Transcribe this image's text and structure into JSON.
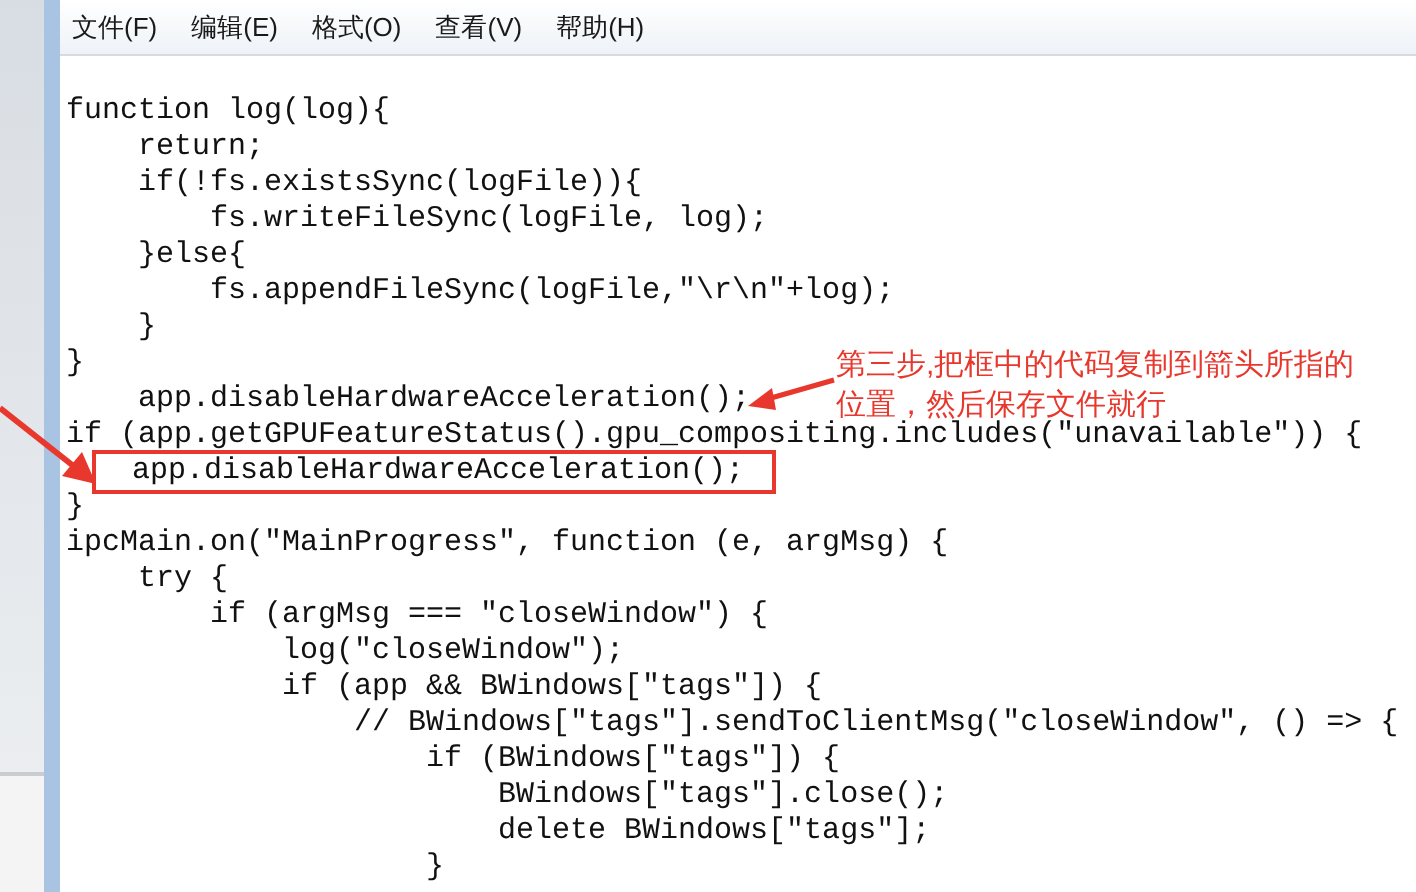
{
  "menu": [
    "文件(F)",
    "编辑(E)",
    "格式(O)",
    "查看(V)",
    "帮助(H)"
  ],
  "code_lines": [
    {
      "text": "function log(log){",
      "boxed": false
    },
    {
      "text": "    return;",
      "boxed": false
    },
    {
      "text": "    if(!fs.existsSync(logFile)){",
      "boxed": false
    },
    {
      "text": "        fs.writeFileSync(logFile, log);",
      "boxed": false
    },
    {
      "text": "    }else{",
      "boxed": false
    },
    {
      "text": "        fs.appendFileSync(logFile,\"\\r\\n\"+log);",
      "boxed": false
    },
    {
      "text": "    }",
      "boxed": false
    },
    {
      "text": "}",
      "boxed": false
    },
    {
      "text": "    app.disableHardwareAcceleration();",
      "boxed": false
    },
    {
      "text": "if (app.getGPUFeatureStatus().gpu_compositing.includes(\"unavailable\")) {",
      "boxed": false
    },
    {
      "text": "    app.disableHardwareAcceleration();",
      "boxed": true
    },
    {
      "text": "}",
      "boxed": false
    },
    {
      "text": "ipcMain.on(\"MainProgress\", function (e, argMsg) {",
      "boxed": false
    },
    {
      "text": "    try {",
      "boxed": false
    },
    {
      "text": "        if (argMsg === \"closeWindow\") {",
      "boxed": false
    },
    {
      "text": "            log(\"closeWindow\");",
      "boxed": false
    },
    {
      "text": "            if (app && BWindows[\"tags\"]) {",
      "boxed": false
    },
    {
      "text": "                // BWindows[\"tags\"].sendToClientMsg(\"closeWindow\", () => {",
      "boxed": false
    },
    {
      "text": "                    if (BWindows[\"tags\"]) {",
      "boxed": false
    },
    {
      "text": "                        BWindows[\"tags\"].close();",
      "boxed": false
    },
    {
      "text": "                        delete BWindows[\"tags\"];",
      "boxed": false
    },
    {
      "text": "                    }",
      "boxed": false
    }
  ],
  "annotation": {
    "text": "第三步,把框中的代码复制到箭头所指的位置，然后保存文件就行"
  }
}
